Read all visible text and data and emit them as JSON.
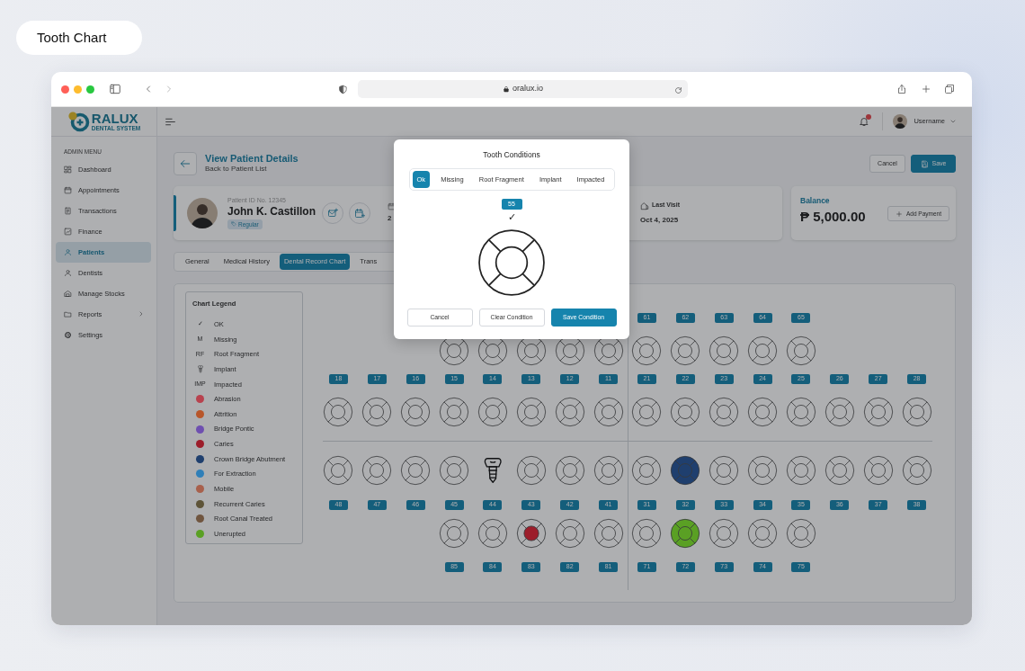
{
  "page_label": "Tooth Chart",
  "browser": {
    "url": "oralux.io"
  },
  "logo": {
    "wordmark": "RALUX",
    "tagline": "DENTAL SYSTEM"
  },
  "sidebar": {
    "heading": "ADMIN MENU",
    "items": [
      {
        "label": "Dashboard",
        "selected": false,
        "expandable": false
      },
      {
        "label": "Appointments",
        "selected": false,
        "expandable": false
      },
      {
        "label": "Transactions",
        "selected": false,
        "expandable": false
      },
      {
        "label": "Finance",
        "selected": false,
        "expandable": false
      },
      {
        "label": "Patients",
        "selected": true,
        "expandable": false
      },
      {
        "label": "Dentists",
        "selected": false,
        "expandable": false
      },
      {
        "label": "Manage Stocks",
        "selected": false,
        "expandable": false
      },
      {
        "label": "Reports",
        "selected": false,
        "expandable": true
      },
      {
        "label": "Settings",
        "selected": false,
        "expandable": false
      }
    ]
  },
  "topbar": {
    "has_notifications": true,
    "username": "Username"
  },
  "header": {
    "title": "View Patient Details",
    "subtitle": "Back to Patient List",
    "buttons": [
      {
        "label": "Cancel",
        "kind": "secondary"
      },
      {
        "label": "Save",
        "kind": "primary"
      }
    ]
  },
  "patient": {
    "id_label": "Patient ID No. 12345",
    "name": "John K. Castillon",
    "tag": "Regular",
    "info_value": "2",
    "last_visit_label": "Last Visit",
    "last_visit": "Oct 4, 2025"
  },
  "balance": {
    "label": "Balance",
    "amount": "₱ 5,000.00",
    "button": "Add Payment"
  },
  "tabs": [
    {
      "label": "General",
      "selected": false
    },
    {
      "label": "Medical History",
      "selected": false
    },
    {
      "label": "Dental Record Chart",
      "selected": true
    },
    {
      "label": "Trans",
      "selected": false
    }
  ],
  "legend": {
    "title": "Chart Legend",
    "items": [
      {
        "kind": "symbol",
        "symbol": "✓",
        "label": "OK"
      },
      {
        "kind": "symbol",
        "symbol": "M",
        "label": "Missing"
      },
      {
        "kind": "symbol",
        "symbol": "RF",
        "label": "Root Fragment"
      },
      {
        "kind": "implant",
        "label": "Implant"
      },
      {
        "kind": "symbol",
        "symbol": "IMP",
        "label": "Impacted"
      },
      {
        "kind": "color",
        "color": "#b8424e",
        "label": "Abrasion"
      },
      {
        "kind": "color",
        "color": "#b8562a",
        "label": "Attrition"
      },
      {
        "kind": "color",
        "color": "#6e4fb0",
        "label": "Bridge Pontic"
      },
      {
        "kind": "color",
        "color": "#9c1d2a",
        "label": "Caries"
      },
      {
        "kind": "color",
        "color": "#1f3f6e",
        "label": "Crown Bridge Abutment"
      },
      {
        "kind": "color",
        "color": "#2f7fb8",
        "label": "For Extraction"
      },
      {
        "kind": "color",
        "color": "#a8604c",
        "label": "Mobile"
      },
      {
        "kind": "color",
        "color": "#5e5438",
        "label": "Recurrent Caries"
      },
      {
        "kind": "color",
        "color": "#70553f",
        "label": "Root Canal Treated"
      },
      {
        "kind": "color",
        "color": "#5aa024",
        "label": "Unerupted"
      }
    ]
  },
  "chart": {
    "upper_primary": [
      {
        "kind": "plain"
      },
      {
        "kind": "plain"
      },
      {
        "kind": "plain"
      },
      {
        "kind": "plain"
      },
      {
        "kind": "plain"
      },
      {
        "number": "61",
        "kind": "plain"
      },
      {
        "number": "62",
        "kind": "plain"
      },
      {
        "number": "63",
        "kind": "plain"
      },
      {
        "number": "64",
        "kind": "plain"
      },
      {
        "number": "65",
        "kind": "plain"
      }
    ],
    "upper_permanent": [
      {
        "number": "18",
        "kind": "plain"
      },
      {
        "number": "17",
        "kind": "plain"
      },
      {
        "number": "16",
        "kind": "plain"
      },
      {
        "number": "15",
        "kind": "plain"
      },
      {
        "number": "14",
        "kind": "plain"
      },
      {
        "number": "13",
        "kind": "plain"
      },
      {
        "number": "12",
        "kind": "plain"
      },
      {
        "number": "11",
        "kind": "plain"
      },
      {
        "number": "21",
        "kind": "plain"
      },
      {
        "number": "22",
        "kind": "plain"
      },
      {
        "number": "23",
        "kind": "plain"
      },
      {
        "number": "24",
        "kind": "plain"
      },
      {
        "number": "25",
        "kind": "plain"
      },
      {
        "number": "26",
        "kind": "plain"
      },
      {
        "number": "27",
        "kind": "plain"
      },
      {
        "number": "28",
        "kind": "plain"
      }
    ],
    "lower_permanent": [
      {
        "number": "48",
        "kind": "plain"
      },
      {
        "number": "47",
        "kind": "plain"
      },
      {
        "number": "46",
        "kind": "plain"
      },
      {
        "number": "45",
        "kind": "plain"
      },
      {
        "number": "44",
        "kind": "implant"
      },
      {
        "number": "43",
        "kind": "plain"
      },
      {
        "number": "42",
        "kind": "plain"
      },
      {
        "number": "41",
        "kind": "plain"
      },
      {
        "number": "31",
        "kind": "plain"
      },
      {
        "number": "32",
        "kind": "filled",
        "color": "#1f3f6e"
      },
      {
        "number": "33",
        "kind": "plain"
      },
      {
        "number": "34",
        "kind": "plain"
      },
      {
        "number": "35",
        "kind": "plain"
      },
      {
        "number": "36",
        "kind": "plain"
      },
      {
        "number": "37",
        "kind": "plain"
      },
      {
        "number": "38",
        "kind": "plain"
      }
    ],
    "lower_primary": [
      {
        "number": "85",
        "kind": "plain"
      },
      {
        "number": "84",
        "kind": "plain"
      },
      {
        "number": "83",
        "kind": "center",
        "color": "#9c1d2a"
      },
      {
        "number": "82",
        "kind": "plain"
      },
      {
        "number": "81",
        "kind": "plain"
      },
      {
        "number": "71",
        "kind": "plain"
      },
      {
        "number": "72",
        "kind": "filled",
        "color": "#5aa024"
      },
      {
        "number": "73",
        "kind": "plain"
      },
      {
        "number": "74",
        "kind": "plain"
      },
      {
        "number": "75",
        "kind": "plain"
      }
    ]
  },
  "modal": {
    "title": "Tooth Conditions",
    "options": [
      {
        "label": "Ok",
        "selected": true
      },
      {
        "label": "Missing",
        "selected": false
      },
      {
        "label": "Root Fragment",
        "selected": false
      },
      {
        "label": "Implant",
        "selected": false
      },
      {
        "label": "Impacted",
        "selected": false
      }
    ],
    "tooth_number": "55",
    "status_symbol": "✓",
    "buttons": [
      {
        "label": "Cancel",
        "kind": "secondary"
      },
      {
        "label": "Clear Condition",
        "kind": "secondary"
      },
      {
        "label": "Save Condition",
        "kind": "primary"
      }
    ]
  }
}
